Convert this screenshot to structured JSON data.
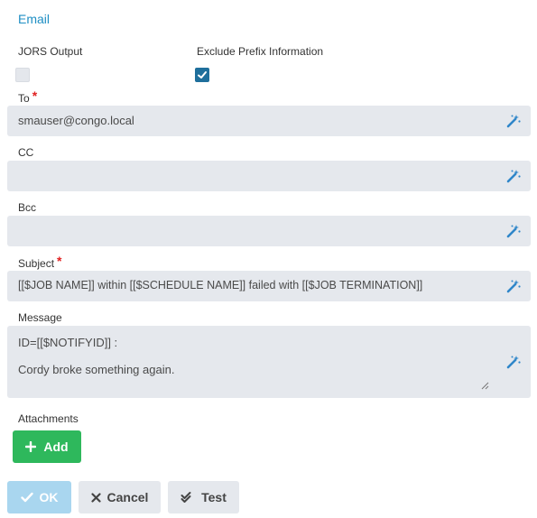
{
  "section_title": "Email",
  "options": {
    "jors_output_label": "JORS Output",
    "jors_output_checked": false,
    "exclude_prefix_label": "Exclude Prefix Information",
    "exclude_prefix_checked": true
  },
  "fields": {
    "to": {
      "label": "To",
      "required": "*",
      "value": "smauser@congo.local"
    },
    "cc": {
      "label": "CC",
      "value": ""
    },
    "bcc": {
      "label": "Bcc",
      "value": ""
    },
    "subject": {
      "label": "Subject",
      "required": "*",
      "value": "[[$JOB NAME]] within [[$SCHEDULE NAME]] failed with [[$JOB TERMINATION]]"
    },
    "message": {
      "label": "Message",
      "line1": "ID=[[$NOTIFYID]] :",
      "line2": "Cordy broke something again."
    }
  },
  "attachments": {
    "label": "Attachments",
    "add_button": "Add"
  },
  "footer": {
    "ok": "OK",
    "cancel": "Cancel",
    "test": "Test"
  },
  "colors": {
    "accent": "#1f8fc4",
    "add_green": "#2eb85c",
    "ok_disabled": "#a9d6ef",
    "field_bg": "#e5e8ed",
    "checkbox_on": "#1f6f9c",
    "wand": "#2f86c9"
  },
  "icons": [
    "magic-wand-icon",
    "check-icon",
    "plus-icon",
    "close-icon",
    "double-check-icon"
  ]
}
